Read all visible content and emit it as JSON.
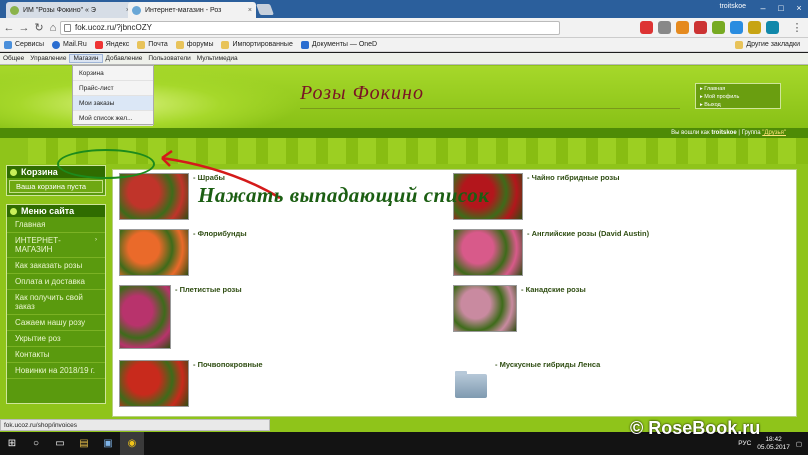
{
  "browser": {
    "tabs": [
      {
        "title": "ИМ \"Розы Фокино\" « Э",
        "active": false
      },
      {
        "title": "Интернет-магазин - Роз",
        "active": true
      }
    ],
    "user": "troitskoe",
    "url": "fok.ucoz.ru/?jbncOZY",
    "bookmarks": [
      "Сервисы",
      "Mail.Ru",
      "Яндекс",
      "Почта",
      "форумы",
      "Импортированные",
      "Документы — OneD"
    ],
    "bookmarks_right": "Другие закладки"
  },
  "admin_bar": {
    "items": [
      "Общее",
      "Управление",
      "Магазин",
      "Добавление",
      "Пользователи",
      "Мультимедиа"
    ],
    "dropdown": [
      "Корзина",
      "Прайс-лист",
      "Мои заказы",
      "Мой список жел..."
    ]
  },
  "site": {
    "title": "Розы  Фокино",
    "toplinks": [
      "Главная",
      "Мой профиль",
      "Выход"
    ],
    "login_prefix": "Вы вошли как",
    "login_user": "troitskoe",
    "group_label": "Группа",
    "group_name": "\"Друзья\""
  },
  "cart": {
    "title": "Корзина",
    "text": "Ваша корзина пуста"
  },
  "menu": {
    "title": "Меню сайта",
    "items": [
      "Главная",
      "ИНТЕРНЕТ-МАГАЗИН",
      "Как заказать розы",
      "Оплата и доставка",
      "Как получить свой заказ",
      "Сажаем нашу розу",
      "Укрытие роз",
      "Контакты",
      "Новинки на 2018/19 г."
    ]
  },
  "products": [
    {
      "label": "- Шрабы",
      "color": "#c0342a"
    },
    {
      "label": "- Чайно гибридные розы",
      "color": "#b3161c"
    },
    {
      "label": "- Флорибунды",
      "color": "#ea6a2a"
    },
    {
      "label": "- Английские розы (David Austin)",
      "color": "#d85a8a"
    },
    {
      "label": "- Плетистые розы",
      "color": "#b8336c"
    },
    {
      "label": "- Канадские розы",
      "color": "#c98aa0"
    },
    {
      "label": "- Почвопокровные",
      "color": "#c82a1c"
    },
    {
      "label": "- Мускусные гибриды Ленса",
      "color": "folder"
    }
  ],
  "annotation": "Нажать выпадающий список",
  "status_url": "fok.ucoz.ru/shop/invoices",
  "taskbar": {
    "lang": "РУС",
    "time": "18:42",
    "date": "05.05.2017"
  },
  "watermark": "© RoseBook.ru"
}
